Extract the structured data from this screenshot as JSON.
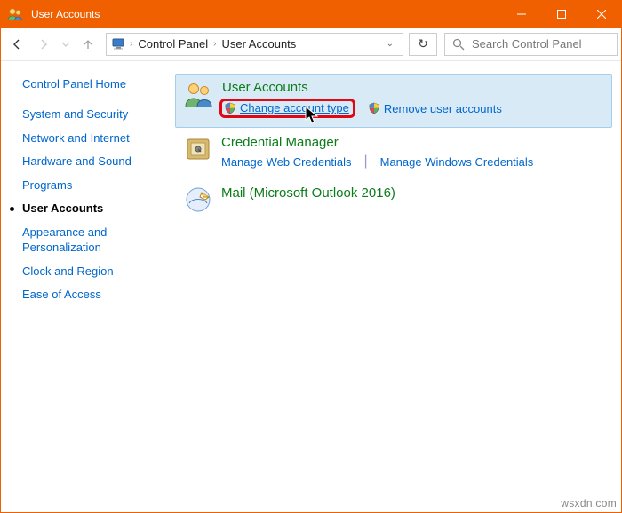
{
  "window": {
    "title": "User Accounts"
  },
  "nav": {
    "breadcrumb": {
      "root_icon": "monitor-icon",
      "part1": "Control Panel",
      "part2": "User Accounts"
    },
    "search_placeholder": "Search Control Panel"
  },
  "sidebar": {
    "home": "Control Panel Home",
    "items": [
      "System and Security",
      "Network and Internet",
      "Hardware and Sound",
      "Programs",
      "User Accounts",
      "Appearance and Personalization",
      "Clock and Region",
      "Ease of Access"
    ],
    "active_index": 4
  },
  "categories": [
    {
      "title": "User Accounts",
      "highlight": true,
      "icon": "users-icon",
      "links": [
        {
          "label": "Change account type",
          "shield": true,
          "boxed": true,
          "underline": true
        },
        {
          "label": "Remove user accounts",
          "shield": true
        }
      ]
    },
    {
      "title": "Credential Manager",
      "icon": "safe-icon",
      "links": [
        {
          "label": "Manage Web Credentials"
        },
        {
          "divider": true
        },
        {
          "label": "Manage Windows Credentials"
        }
      ]
    },
    {
      "title": "Mail (Microsoft Outlook 2016)",
      "icon": "mail-icon",
      "links": []
    }
  ],
  "watermark": "wsxdn.com"
}
